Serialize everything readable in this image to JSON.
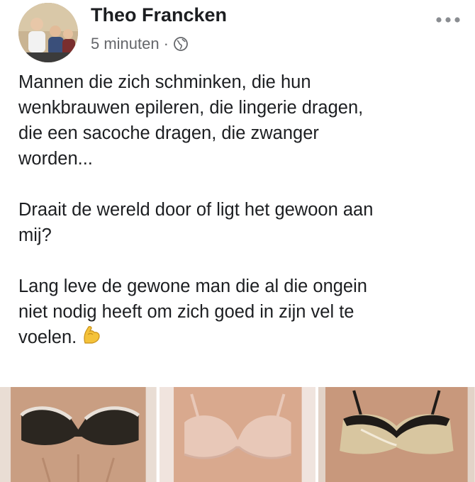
{
  "post": {
    "author": "Theo Francken",
    "time": "5 minuten",
    "separator": "·",
    "privacy_icon": "globe-icon",
    "more_icon": "more-options-icon",
    "paragraphs": [
      "Mannen die zich schminken, die hun\nwenkbrauwen epileren, die lingerie dragen,\ndie een sacoche dragen, die zwanger\nworden...",
      "Draait de wereld door of ligt het gewoon aan\nmij?",
      "Lang leve de gewone man die al die ongein\nniet nodig heeft om zich goed in zijn vel te\nvoelen."
    ],
    "emoji": "flexed-biceps-icon",
    "photos": [
      {
        "name": "photo-black-lace-bra",
        "color": "#2b2620"
      },
      {
        "name": "photo-pink-bra",
        "color": "#e8c8b8"
      },
      {
        "name": "photo-satin-bra",
        "color": "#d8c6a0"
      }
    ]
  }
}
